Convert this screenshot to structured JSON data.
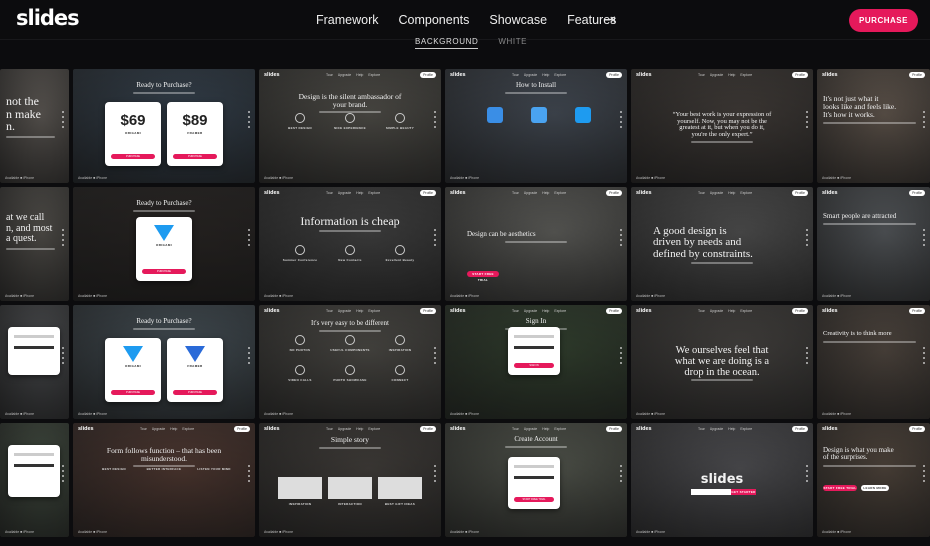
{
  "header": {
    "logo": "slides",
    "nav": [
      "Framework",
      "Components",
      "Showcase",
      "Features"
    ],
    "signin_icon": "sign-in-icon",
    "purchase_label": "PURCHASE",
    "accent": "#e5195b"
  },
  "filter_tabs": [
    {
      "label": "BACKGROUND",
      "active": true
    },
    {
      "label": "WHITE",
      "active": false
    }
  ],
  "mini_chrome": {
    "logo": "slides",
    "nav": "Tour Upgrade Help Explore",
    "profile": "Profile",
    "footer": "Available ■ iPhone"
  },
  "tiles": [
    [
      {
        "bg": "#6a6560",
        "title": "not the\nn make\nn.",
        "size": 14,
        "align": "left",
        "kind": "quote"
      },
      {
        "bg": "#3c4a58",
        "title": "Ready to Purchase?",
        "size": 7,
        "kind": "pricing",
        "cards": [
          {
            "price": "$69",
            "name": "ORIGAMI"
          },
          {
            "price": "$89",
            "name": "FRAMER"
          }
        ],
        "button": "PURCHASE"
      },
      {
        "bg": "#5a5852",
        "chrome": true,
        "title": "Design is the silent ambassador of\nyour brand.",
        "size": 7.5,
        "kind": "features",
        "features": [
          "BEST DESIGN",
          "NICE EXPERIENCE",
          "SIMPLE BEAUTY"
        ]
      },
      {
        "bg": "#4d5560",
        "chrome": true,
        "title": "How to Install",
        "size": 7,
        "kind": "install"
      },
      {
        "bg": "#4a4440",
        "chrome": true,
        "title": "“Your best work is your expression of\nyourself. Now, you may not be the\ngreatest at it, but when you do it,\nyou're the only expert.”",
        "size": 6.5,
        "kind": "quote"
      },
      {
        "bg": "#6e6258",
        "chrome": true,
        "title": "It's not just what it\nlooks like and feels like.\nIt's how it works.",
        "size": 11,
        "kind": "quote",
        "align": "left"
      }
    ],
    [
      {
        "bg": "#5d5a55",
        "title": "at we call\nn, and most\na quest.",
        "size": 10,
        "align": "left",
        "kind": "quote"
      },
      {
        "bg": "#2e2a28",
        "title": "Ready to Purchase?",
        "size": 7,
        "kind": "pricing1",
        "cards": [
          {
            "price": "",
            "name": "ORIGAMI"
          }
        ],
        "button": "PURCHASE"
      },
      {
        "bg": "#4a4a4a",
        "chrome": true,
        "title": "Information is cheap",
        "size": 12,
        "kind": "features",
        "features": [
          "Summer Conference",
          "New Contacts",
          "Excellent Beauty"
        ]
      },
      {
        "bg": "#6a6a66",
        "chrome": true,
        "title": "Design can be aesthetics",
        "size": 7,
        "align": "left",
        "kind": "cta",
        "button": "START FREE TRIAL"
      },
      {
        "bg": "#5a5a5a",
        "chrome": true,
        "title": "A good design is\ndriven by needs and\ndefined by constraints.",
        "size": 11,
        "align": "left",
        "kind": "quote"
      },
      {
        "bg": "#606468",
        "chrome": true,
        "title": "Smart people are attracted",
        "size": 7,
        "kind": "quote"
      }
    ],
    [
      {
        "bg": "#55575a",
        "title": "",
        "size": 7,
        "kind": "form"
      },
      {
        "bg": "#4e5a62",
        "title": "Ready to Purchase?",
        "size": 7,
        "kind": "pricing",
        "cards": [
          {
            "price": "",
            "name": "ORIGAMI"
          },
          {
            "price": "",
            "name": "FRAMER"
          }
        ],
        "button": "PURCHASE"
      },
      {
        "bg": "#55534e",
        "chrome": true,
        "title": "It's very easy to be different",
        "size": 7,
        "kind": "features6",
        "features": [
          "NO PHOTOS",
          "USEFUL COMPONENTS",
          "INSPIRATION",
          "VIDEO CALLS",
          "PHOTO SHOWCASE",
          "CONNECT"
        ]
      },
      {
        "bg": "#3a4a36",
        "chrome": true,
        "title": "Sign In",
        "size": 7,
        "kind": "form",
        "button": "SIGN IN"
      },
      {
        "bg": "#4e4b48",
        "chrome": true,
        "title": "We ourselves feel that\nwhat we are doing is a\ndrop in the ocean.",
        "size": 10.5,
        "kind": "quote"
      },
      {
        "bg": "#5a5048",
        "chrome": true,
        "title": "Creativity is to think more",
        "size": 6.5,
        "kind": "quote"
      }
    ],
    [
      {
        "bg": "#4a5548",
        "title": "",
        "size": 7,
        "kind": "form"
      },
      {
        "bg": "#5a4038",
        "chrome": true,
        "title": "Form follows function – that has been\nmisunderstood.",
        "size": 7.5,
        "kind": "features",
        "features": [
          "BEST DESIGN",
          "BETTER INTERFACE",
          "LISTEN YOUR MIND"
        ]
      },
      {
        "bg": "#4a4642",
        "chrome": true,
        "title": "Simple story",
        "size": 7.5,
        "kind": "story",
        "features": [
          "INSPIRATION",
          "INTERACTION",
          "BEST GIFT IDEAS"
        ]
      },
      {
        "bg": "#5e6258",
        "chrome": true,
        "title": "Create Account",
        "size": 7,
        "kind": "form",
        "button": "START FREE TRIAL"
      },
      {
        "bg": "#5a5a5e",
        "chrome": true,
        "title": "slides",
        "size": 13,
        "kind": "hero",
        "button": "GET STARTED"
      },
      {
        "bg": "#5a4e44",
        "chrome": true,
        "title": "Design is what you make\nof the surprises.",
        "size": 7,
        "align": "left",
        "kind": "cta2",
        "button": "START FREE TRIAL",
        "button2": "LEARN MORE"
      }
    ]
  ]
}
